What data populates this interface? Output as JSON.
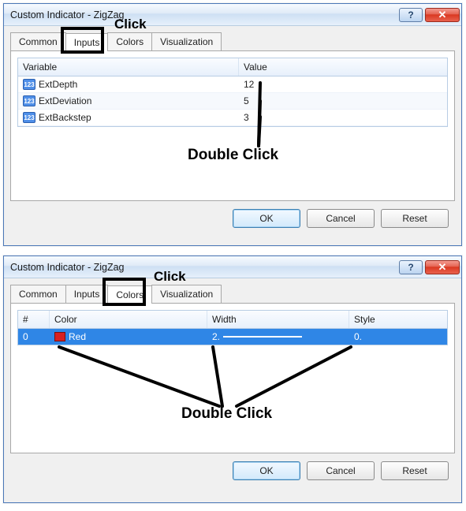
{
  "dialog1": {
    "title": "Custom Indicator - ZigZag",
    "tabs": {
      "common": "Common",
      "inputs": "Inputs",
      "colors": "Colors",
      "visualization": "Visualization"
    },
    "grid": {
      "head_var": "Variable",
      "head_val": "Value",
      "rows": [
        {
          "name": "ExtDepth",
          "value": "12"
        },
        {
          "name": "ExtDeviation",
          "value": "5"
        },
        {
          "name": "ExtBackstep",
          "value": "3"
        }
      ]
    },
    "buttons": {
      "ok": "OK",
      "cancel": "Cancel",
      "reset": "Reset"
    }
  },
  "dialog2": {
    "title": "Custom Indicator - ZigZag",
    "tabs": {
      "common": "Common",
      "inputs": "Inputs",
      "colors": "Colors",
      "visualization": "Visualization"
    },
    "grid": {
      "head_num": "#",
      "head_color": "Color",
      "head_width": "Width",
      "head_style": "Style",
      "row": {
        "num": "0",
        "color": "Red",
        "width": "2.",
        "style": "0."
      }
    },
    "buttons": {
      "ok": "OK",
      "cancel": "Cancel",
      "reset": "Reset"
    }
  },
  "annotations": {
    "click1": "Click",
    "dbl1": "Double Click",
    "click2": "Click",
    "dbl2": "Double Click"
  },
  "icons": {
    "help": "?",
    "close": "✕",
    "var": "123"
  }
}
